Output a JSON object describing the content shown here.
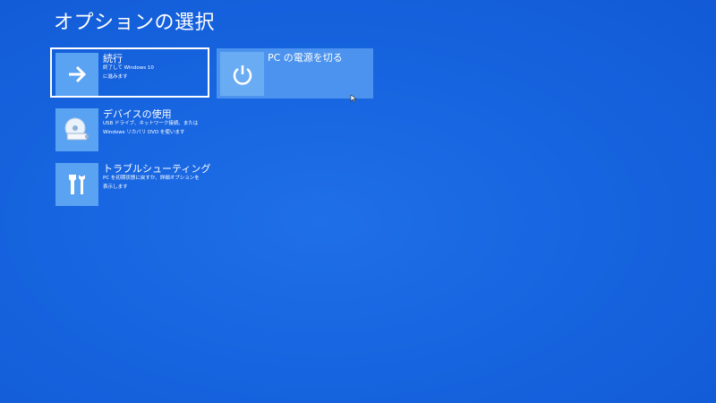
{
  "page": {
    "title": "オプションの選択"
  },
  "options": [
    {
      "title": "続行",
      "description": "終了して Windows 10\nに進みます",
      "icon": "arrow-right-icon"
    },
    {
      "title": "PC の電源を切る",
      "description": "",
      "icon": "power-icon"
    },
    {
      "title": "デバイスの使用",
      "description": "USB ドライブ、ネットワーク接続、または\nWindows リカバリ DVD を使います",
      "icon": "disc-drive-icon"
    },
    {
      "title": "トラブルシューティング",
      "description": "PC を初期状態に戻すか、詳細オプションを\n表示します",
      "icon": "tools-icon"
    }
  ],
  "colors": {
    "background": "#1765e0",
    "icon_tile": "#5aa2f2",
    "hover_tile": "#4b93ee",
    "text": "#ffffff"
  }
}
